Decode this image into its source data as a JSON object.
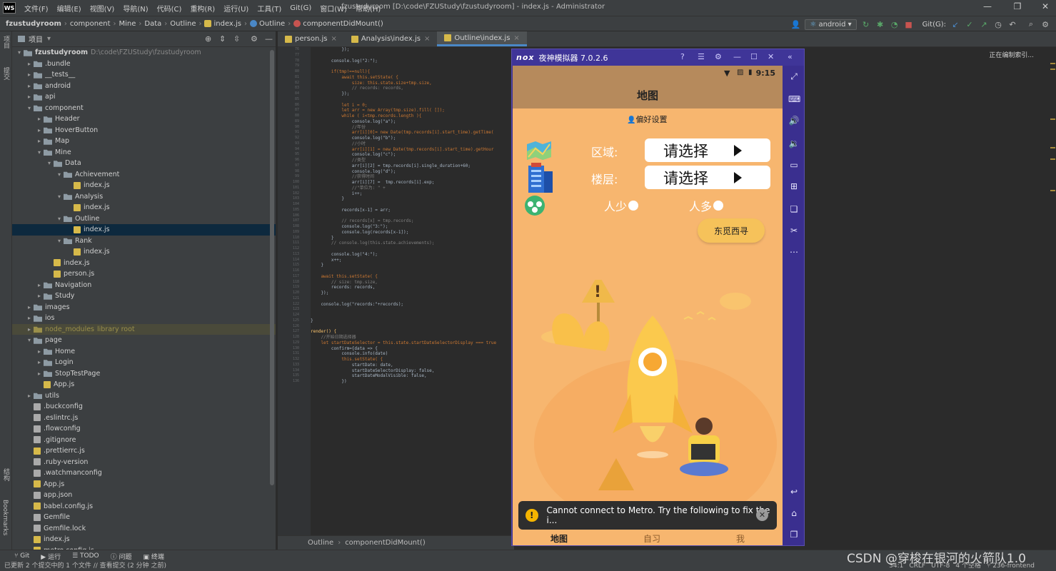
{
  "menubar": {
    "logo": "WS",
    "items": [
      "文件(F)",
      "编辑(E)",
      "视图(V)",
      "导航(N)",
      "代码(C)",
      "重构(R)",
      "运行(U)",
      "工具(T)",
      "Git(G)",
      "窗口(W)",
      "帮助(H)"
    ],
    "window_title": "fzustudyroom [D:\\code\\FZUStudy\\fzustudyroom] - index.js - Administrator"
  },
  "breadcrumb": {
    "items": [
      "fzustudyroom",
      "component",
      "Mine",
      "Data",
      "Outline",
      "index.js",
      "Outline",
      "componentDidMount()"
    ],
    "run_config": "android",
    "git_label": "Git(G):"
  },
  "left_strip": {
    "top_tab": "项目",
    "mid_tab": "提交",
    "bottom_tab_1": "结构",
    "bottom_tab_2": "Bookmarks"
  },
  "project_panel": {
    "title": "项目",
    "tree": [
      {
        "depth": 0,
        "arrow": "▾",
        "icon": "folder",
        "label": "fzustudyroom",
        "hint": "D:\\code\\FZUStudy\\fzustudyroom",
        "bold": true
      },
      {
        "depth": 1,
        "arrow": "▸",
        "icon": "folder",
        "label": ".bundle"
      },
      {
        "depth": 1,
        "arrow": "▸",
        "icon": "folder",
        "label": "__tests__"
      },
      {
        "depth": 1,
        "arrow": "▸",
        "icon": "folder",
        "label": "android"
      },
      {
        "depth": 1,
        "arrow": "▸",
        "icon": "folder",
        "label": "api"
      },
      {
        "depth": 1,
        "arrow": "▾",
        "icon": "folder",
        "label": "component"
      },
      {
        "depth": 2,
        "arrow": "▸",
        "icon": "folder",
        "label": "Header"
      },
      {
        "depth": 2,
        "arrow": "▸",
        "icon": "folder",
        "label": "HoverButton"
      },
      {
        "depth": 2,
        "arrow": "▸",
        "icon": "folder",
        "label": "Map"
      },
      {
        "depth": 2,
        "arrow": "▾",
        "icon": "folder",
        "label": "Mine"
      },
      {
        "depth": 3,
        "arrow": "▾",
        "icon": "folder",
        "label": "Data"
      },
      {
        "depth": 4,
        "arrow": "▾",
        "icon": "folder",
        "label": "Achievement"
      },
      {
        "depth": 5,
        "arrow": "",
        "icon": "js",
        "label": "index.js"
      },
      {
        "depth": 4,
        "arrow": "▾",
        "icon": "folder",
        "label": "Analysis"
      },
      {
        "depth": 5,
        "arrow": "",
        "icon": "js",
        "label": "index.js"
      },
      {
        "depth": 4,
        "arrow": "▾",
        "icon": "folder",
        "label": "Outline"
      },
      {
        "depth": 5,
        "arrow": "",
        "icon": "js",
        "label": "index.js",
        "selected": true
      },
      {
        "depth": 4,
        "arrow": "▾",
        "icon": "folder",
        "label": "Rank"
      },
      {
        "depth": 5,
        "arrow": "",
        "icon": "js",
        "label": "index.js"
      },
      {
        "depth": 3,
        "arrow": "",
        "icon": "js",
        "label": "index.js"
      },
      {
        "depth": 3,
        "arrow": "",
        "icon": "js",
        "label": "person.js"
      },
      {
        "depth": 2,
        "arrow": "▸",
        "icon": "folder",
        "label": "Navigation"
      },
      {
        "depth": 2,
        "arrow": "▸",
        "icon": "folder",
        "label": "Study"
      },
      {
        "depth": 1,
        "arrow": "▸",
        "icon": "folder",
        "label": "images"
      },
      {
        "depth": 1,
        "arrow": "▸",
        "icon": "folder",
        "label": "ios"
      },
      {
        "depth": 1,
        "arrow": "▸",
        "icon": "folder",
        "label": "node_modules",
        "hint": "library root",
        "lib": true
      },
      {
        "depth": 1,
        "arrow": "▾",
        "icon": "folder",
        "label": "page"
      },
      {
        "depth": 2,
        "arrow": "▸",
        "icon": "folder",
        "label": "Home"
      },
      {
        "depth": 2,
        "arrow": "▸",
        "icon": "folder",
        "label": "Login"
      },
      {
        "depth": 2,
        "arrow": "▸",
        "icon": "folder",
        "label": "StopTestPage"
      },
      {
        "depth": 2,
        "arrow": "",
        "icon": "js",
        "label": "App.js"
      },
      {
        "depth": 1,
        "arrow": "▸",
        "icon": "folder",
        "label": "utils"
      },
      {
        "depth": 1,
        "arrow": "",
        "icon": "cfg",
        "label": ".buckconfig"
      },
      {
        "depth": 1,
        "arrow": "",
        "icon": "cfg",
        "label": ".eslintrc.js"
      },
      {
        "depth": 1,
        "arrow": "",
        "icon": "cfg",
        "label": ".flowconfig"
      },
      {
        "depth": 1,
        "arrow": "",
        "icon": "cfg",
        "label": ".gitignore"
      },
      {
        "depth": 1,
        "arrow": "",
        "icon": "js",
        "label": ".prettierrc.js"
      },
      {
        "depth": 1,
        "arrow": "",
        "icon": "cfg",
        "label": ".ruby-version"
      },
      {
        "depth": 1,
        "arrow": "",
        "icon": "cfg",
        "label": ".watchmanconfig"
      },
      {
        "depth": 1,
        "arrow": "",
        "icon": "js",
        "label": "App.js"
      },
      {
        "depth": 1,
        "arrow": "",
        "icon": "cfg",
        "label": "app.json"
      },
      {
        "depth": 1,
        "arrow": "",
        "icon": "js",
        "label": "babel.config.js"
      },
      {
        "depth": 1,
        "arrow": "",
        "icon": "cfg",
        "label": "Gemfile"
      },
      {
        "depth": 1,
        "arrow": "",
        "icon": "cfg",
        "label": "Gemfile.lock"
      },
      {
        "depth": 1,
        "arrow": "",
        "icon": "js",
        "label": "index.js"
      },
      {
        "depth": 1,
        "arrow": "",
        "icon": "js",
        "label": "metro.config.js"
      }
    ]
  },
  "editor_tabs": [
    {
      "label": "person.js",
      "active": false
    },
    {
      "label": "Analysis\\index.js",
      "active": false
    },
    {
      "label": "Outline\\index.js",
      "active": true
    }
  ],
  "code_lines": [
    [
      "cl",
      "            });"
    ],
    [
      "cl",
      ""
    ],
    [
      "cl",
      "        console.log(\"2:\");"
    ],
    [
      "cl",
      ""
    ],
    [
      "cl",
      "        if(tmp!==null){"
    ],
    [
      "cl",
      "            await this.setState( {"
    ],
    [
      "cl",
      "                size: this.state.size+tmp.size,"
    ],
    [
      "cl",
      "                // records: records,"
    ],
    [
      "cl",
      "            });"
    ],
    [
      "cl",
      ""
    ],
    [
      "cl",
      "            let i = 0;"
    ],
    [
      "cl",
      "            let arr = new Array(tmp.size).fill( []);"
    ],
    [
      "cl",
      "            while ( i<tmp.records.length ){"
    ],
    [
      "cl",
      "                console.log(\"a\");"
    ],
    [
      "cl",
      "                //年份"
    ],
    [
      "cl",
      "                arr[i][0]= new Date(tmp.records[i].start_time).getTime("
    ],
    [
      "cl",
      "                console.log(\"b\");"
    ],
    [
      "cl",
      "                //小时"
    ],
    [
      "cl",
      "                arr[i][1] = new Date(tmp.records[i].start_time).getHour"
    ],
    [
      "cl",
      "                console.log(\"c\");"
    ],
    [
      "cl",
      "                //类型"
    ],
    [
      "cl",
      "                arr[i][2] = tmp.records[i].single_duration+60;"
    ],
    [
      "cl",
      "                console.log(\"d\");"
    ],
    [
      "cl",
      "                //获得时间"
    ],
    [
      "cl",
      "                arr[i][7] =  tmp.records[i].exp;"
    ],
    [
      "cl",
      "                //\"单位为: \" +"
    ],
    [
      "cl",
      "                i++;"
    ],
    [
      "cl",
      "            }"
    ],
    [
      "cl",
      ""
    ],
    [
      "cl",
      "            records[x-1] = arr;"
    ],
    [
      "cl",
      ""
    ],
    [
      "cl",
      "            // records[x] = tmp.records;"
    ],
    [
      "cl",
      "            console.log(\"3:\");"
    ],
    [
      "cl",
      "            console.log(records[x-1]);"
    ],
    [
      "cl",
      "        }"
    ],
    [
      "cl",
      "        // console.log(this.state.achievements);"
    ],
    [
      "cl",
      ""
    ],
    [
      "cl",
      "        console.log(\"4:\");"
    ],
    [
      "cl",
      "        x++;"
    ],
    [
      "cl",
      "    }"
    ],
    [
      "cl",
      ""
    ],
    [
      "cl",
      "    await this.setState( {"
    ],
    [
      "cl",
      "        // size: tmp.size,"
    ],
    [
      "cl",
      "        records: records,"
    ],
    [
      "cl",
      "    });"
    ],
    [
      "cl",
      ""
    ],
    [
      "cl",
      "    console.log(\"records:\"+records);"
    ],
    [
      "cl",
      ""
    ],
    [
      "cl",
      ""
    ],
    [
      "cl",
      "}"
    ],
    [
      "cl",
      ""
    ],
    [
      "cl",
      "render() {"
    ],
    [
      "cl",
      "    //开始日期选择器"
    ],
    [
      "cl",
      "    let startDateSelector = this.state.startDateSelectorDisplay === true"
    ],
    [
      "cl",
      "        confirm={data => {"
    ],
    [
      "cl",
      "            console.info(date)"
    ],
    [
      "cl",
      "            this.setState( {"
    ],
    [
      "cl",
      "                startDate: date,"
    ],
    [
      "cl",
      "                startDateSelectorDisplay: false,"
    ],
    [
      "cl",
      "                startDateModalVisible: false,"
    ],
    [
      "cl",
      "            })"
    ]
  ],
  "line_numbers_start": 76,
  "editor_breadcrumb": [
    "Outline",
    "componentDidMount()"
  ],
  "right_panel": {
    "indexing": "正在编制索引..."
  },
  "bottom_toolbar": [
    {
      "icon": "git-icon",
      "label": "Git"
    },
    {
      "icon": "run-icon",
      "label": "运行"
    },
    {
      "icon": "todo-icon",
      "label": "TODO"
    },
    {
      "icon": "problems-icon",
      "label": "问题"
    },
    {
      "icon": "terminal-icon",
      "label": "终端"
    }
  ],
  "status": {
    "message": "已更新 2 个提交中的 1 个文件 // 查看提交 (2 分钟 之前)",
    "position": "34:1",
    "line_sep": "CRLF",
    "encoding": "UTF-8",
    "indent": "4 个空格",
    "branch": "236-frontend"
  },
  "watermark": "CSDN @穿梭在银河的火箭队1.0",
  "emulator": {
    "title": "夜神模拟器 7.0.2.6",
    "brand": "nox",
    "phone": {
      "time": "9:15",
      "header_title": "地图",
      "prefs_label": "偏好设置",
      "area_label": "区域:",
      "floor_label": "楼层:",
      "select_placeholder": "请选择",
      "radio_few": "人少",
      "radio_many": "人多",
      "search_button": "东觅西寻",
      "toast_message": "Cannot connect to Metro.  Try the following to fix the i...",
      "tabs": [
        "地图",
        "自习",
        "我"
      ]
    }
  },
  "colors": {
    "ide_bg": "#2b2b2b",
    "panel_bg": "#3c3f41",
    "selection": "#0d293e",
    "emulator_frame": "#3a2f8f",
    "phone_bg": "#f7b66f",
    "phone_header": "#b68a5c",
    "search_btn": "#f6c25a"
  }
}
